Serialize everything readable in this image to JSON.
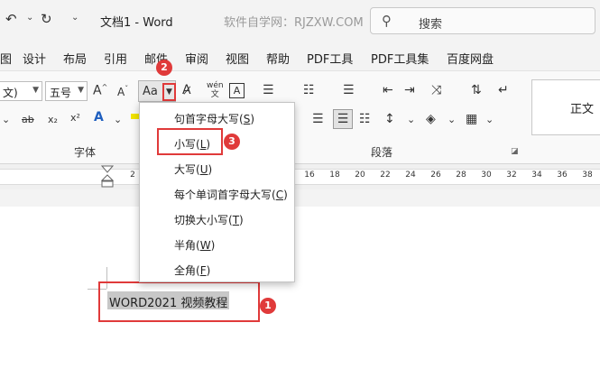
{
  "titlebar": {
    "doc_title": "文档1  -  Word",
    "watermark": "软件自学网：RJZXW.COM",
    "search_label": "搜索"
  },
  "tabs": [
    "图",
    "设计",
    "布局",
    "引用",
    "邮件",
    "审阅",
    "视图",
    "帮助",
    "PDF工具",
    "PDF工具集",
    "百度网盘"
  ],
  "ribbon": {
    "font_name": "文)",
    "font_size": "五号",
    "case_button_text": "Aa",
    "font_group_label": "字体",
    "paragraph_group_label": "段落",
    "style_normal": "正文"
  },
  "ruler": {
    "left_ticks": [
      "2"
    ],
    "right_ticks": [
      "16",
      "18",
      "20",
      "22",
      "24",
      "26",
      "28",
      "30",
      "32",
      "34",
      "36",
      "38"
    ]
  },
  "change_case_menu": {
    "items": [
      {
        "label": "句首字母大写",
        "key": "S"
      },
      {
        "label": "小写",
        "key": "L"
      },
      {
        "label": "大写",
        "key": "U"
      },
      {
        "label": "每个单词首字母大写",
        "key": "C"
      },
      {
        "label": "切换大小写",
        "key": "T"
      },
      {
        "label": "半角",
        "key": "W"
      },
      {
        "label": "全角",
        "key": "F"
      }
    ]
  },
  "document": {
    "selected_text": "WORD2021 视频教程"
  },
  "annotations": {
    "badge_1": "1",
    "badge_2": "2",
    "badge_3": "3"
  },
  "colors": {
    "annotation_red": "#e03a3a",
    "selection_gray": "#c8c8c8"
  }
}
